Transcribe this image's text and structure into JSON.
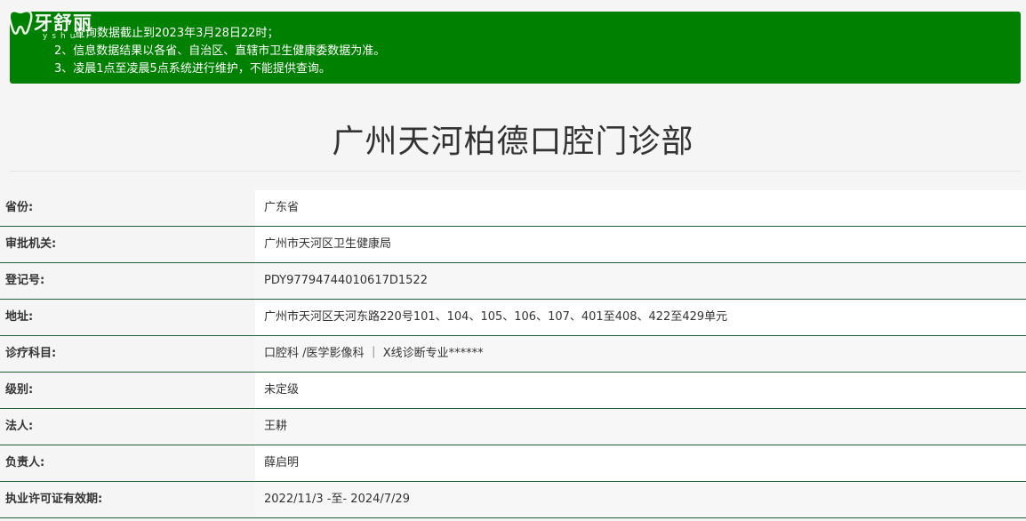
{
  "logo": {
    "brand": "牙舒丽",
    "sub": "yshuli"
  },
  "notice": {
    "line1": "查询数据截止到2023年3月28日22时；",
    "line2": "2、信息数据结果以各省、自治区、直辖市卫生健康委数据为准。",
    "line3": "3、凌晨1点至凌晨5点系统进行维护，不能提供查询。"
  },
  "page_title": "广州天河柏德口腔门诊部",
  "info": [
    {
      "label": "省份:",
      "value": "广东省"
    },
    {
      "label": "审批机关:",
      "value": "广州市天河区卫生健康局"
    },
    {
      "label": "登记号:",
      "value": "PDY97794744010617D1522"
    },
    {
      "label": "地址:",
      "value": "广州市天河区天河东路220号101、104、105、106、107、401至408、422至429单元"
    },
    {
      "label": "诊疗科目:",
      "value": "口腔科 /医学影像科 ｜ X线诊断专业******"
    },
    {
      "label": "级别:",
      "value": "未定级"
    },
    {
      "label": "法人:",
      "value": "王耕"
    },
    {
      "label": "负责人:",
      "value": "薛启明"
    },
    {
      "label": "执业许可证有效期:",
      "value": "2022/11/3 -至- 2024/7/29"
    }
  ]
}
